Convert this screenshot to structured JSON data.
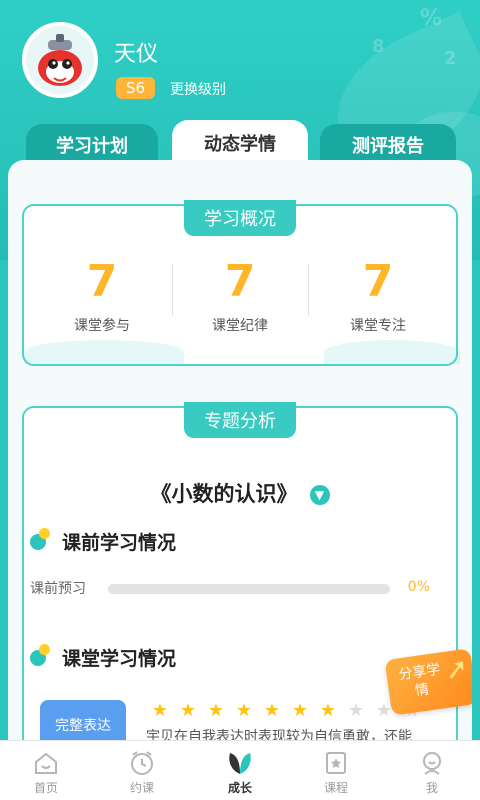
{
  "user": {
    "name": "天仪",
    "level": "S6",
    "change_level": "更换级别"
  },
  "tabs": [
    {
      "label": "学习计划",
      "active": false
    },
    {
      "label": "动态学情",
      "active": true
    },
    {
      "label": "测评报告",
      "active": false
    }
  ],
  "overview": {
    "title": "学习概况",
    "stats": [
      {
        "value": "7",
        "label": "课堂参与"
      },
      {
        "value": "7",
        "label": "课堂纪律"
      },
      {
        "value": "7",
        "label": "课堂专注"
      }
    ]
  },
  "topic_analysis": {
    "title": "专题分析",
    "topic": "《小数的认识》",
    "pre_class": {
      "title": "课前学习情况",
      "preview_label": "课前预习",
      "progress_percent": 0,
      "progress_text": "0%"
    },
    "in_class": {
      "title": "课堂学习情况",
      "button_label": "完整表达",
      "stars_on": 7,
      "stars_total": 10,
      "comment": "宇贝在自我表达时表现较为自信勇敢，还能"
    }
  },
  "share": {
    "label": "分享学情"
  },
  "nav": [
    {
      "label": "首页",
      "icon": "home-icon",
      "active": false
    },
    {
      "label": "约课",
      "icon": "clock-icon",
      "active": false
    },
    {
      "label": "成长",
      "icon": "leaf-icon",
      "active": true
    },
    {
      "label": "课程",
      "icon": "star-book-icon",
      "active": false
    },
    {
      "label": "我",
      "icon": "user-icon",
      "active": false
    }
  ],
  "colors": {
    "brand": "#2cc5bd",
    "accent": "#ffb627",
    "button_blue": "#5a9ef0"
  }
}
